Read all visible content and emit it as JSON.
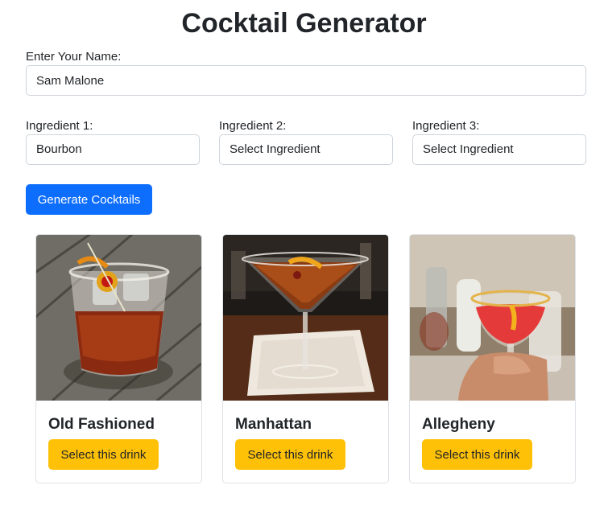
{
  "page": {
    "title": "Cocktail Generator"
  },
  "form": {
    "name_label": "Enter Your Name:",
    "name_value": "Sam Malone",
    "ingredients": [
      {
        "label": "Ingredient 1:",
        "value": "Bourbon"
      },
      {
        "label": "Ingredient 2:",
        "value": "Select Ingredient"
      },
      {
        "label": "Ingredient 3:",
        "value": "Select Ingredient"
      }
    ],
    "generate_label": "Generate Cocktails"
  },
  "cocktails": [
    {
      "name": "Old Fashioned",
      "button_label": "Select this drink"
    },
    {
      "name": "Manhattan",
      "button_label": "Select this drink"
    },
    {
      "name": "Allegheny",
      "button_label": "Select this drink"
    }
  ],
  "colors": {
    "primary": "#0d6efd",
    "warning": "#ffc107",
    "text": "#212529",
    "border": "#ced4da"
  }
}
